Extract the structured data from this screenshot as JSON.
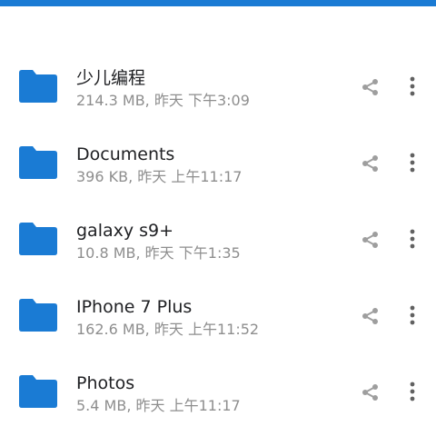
{
  "accent_color": "#1a7bd4",
  "icons": {
    "folder": "folder-icon",
    "share": "share-icon",
    "more": "more-vert-icon"
  },
  "files": [
    {
      "name": "少儿编程",
      "size": "214.3 MB",
      "day": "昨天",
      "time": "下午3:09"
    },
    {
      "name": "Documents",
      "size": "396 KB",
      "day": "昨天",
      "time": "上午11:17"
    },
    {
      "name": "galaxy s9+",
      "size": "10.8 MB",
      "day": "昨天",
      "time": "下午1:35"
    },
    {
      "name": "IPhone 7 Plus",
      "size": "162.6 MB",
      "day": "昨天",
      "time": "上午11:52"
    },
    {
      "name": "Photos",
      "size": "5.4 MB",
      "day": "昨天",
      "time": "上午11:17"
    }
  ]
}
